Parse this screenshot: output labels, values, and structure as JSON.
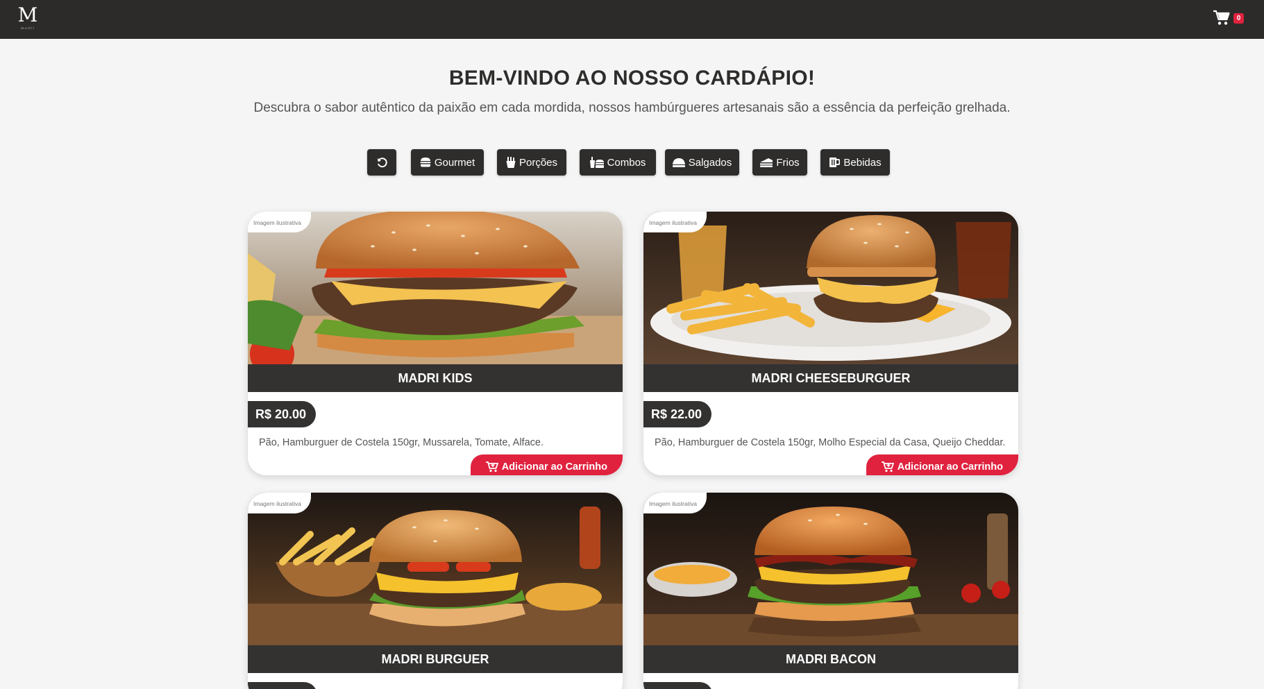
{
  "header": {
    "logo_letter": "M",
    "logo_tagline": "madri",
    "cart_count": "0"
  },
  "hero": {
    "title": "BEM-VINDO AO NOSSO CARDÁPIO!",
    "subtitle": "Descubra o sabor autêntico da paixão em cada mordida, nossos hambúrgueres artesanais são a essência da perfeição grelhada."
  },
  "filters": [
    {
      "label": "",
      "icon": "reset-icon"
    },
    {
      "label": "Gourmet",
      "icon": "burger-icon"
    },
    {
      "label": "Porções",
      "icon": "fries-icon"
    },
    {
      "label": "Combos",
      "icon": "combo-icon"
    },
    {
      "label": "Salgados",
      "icon": "snack-icon"
    },
    {
      "label": "Frios",
      "icon": "sandwich-icon"
    },
    {
      "label": "Bebidas",
      "icon": "beer-mug-icon"
    }
  ],
  "products": [
    {
      "name": "MADRI KIDS",
      "price": "R$ 20.00",
      "description": "Pão, Hamburguer de Costela 150gr, Mussarela, Tomate, Alface.",
      "image_tag": "Imagem ilustrativa",
      "add_label": "Adicionar ao Carrinho"
    },
    {
      "name": "MADRI CHEESEBURGUER",
      "price": "R$ 22.00",
      "description": "Pão, Hamburguer de Costela 150gr, Molho Especial da Casa, Queijo Cheddar.",
      "image_tag": "Imagem ilustrativa",
      "add_label": "Adicionar ao Carrinho"
    },
    {
      "name": "MADRI BURGUER",
      "price": "",
      "description": "",
      "image_tag": "Imagem ilustrativa",
      "add_label": ""
    },
    {
      "name": "MADRI BACON",
      "price": "",
      "description": "",
      "image_tag": "Imagem ilustrativa",
      "add_label": ""
    }
  ],
  "colors": {
    "topbar": "#2c2b2a",
    "dark": "#333231",
    "accent": "#e0223f",
    "page_bg": "#f5f5f5"
  }
}
